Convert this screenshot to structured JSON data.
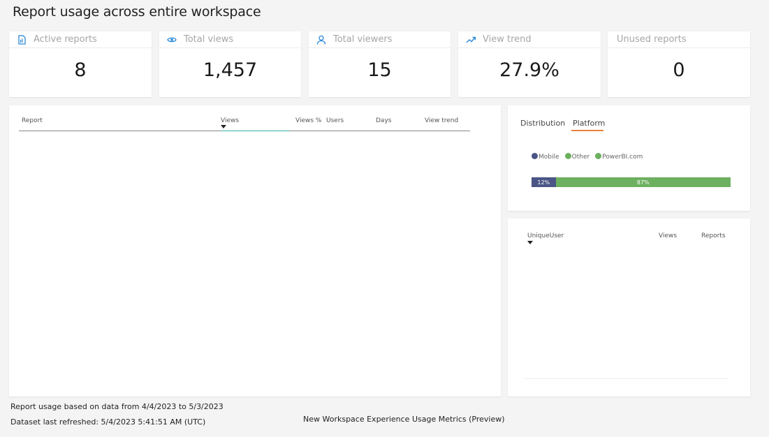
{
  "page": {
    "title": "Report usage across entire workspace"
  },
  "kpis": [
    {
      "label": "Active reports",
      "value": "8",
      "icon": "report-icon"
    },
    {
      "label": "Total views",
      "value": "1,457",
      "icon": "eye-icon"
    },
    {
      "label": "Total viewers",
      "value": "15",
      "icon": "person-icon"
    },
    {
      "label": "View trend",
      "value": "27.9%",
      "icon": "trend-up-icon"
    },
    {
      "label": "Unused reports",
      "value": "0",
      "icon": ""
    }
  ],
  "report_table": {
    "columns": [
      "Report",
      "Views",
      "Views %",
      "Users",
      "Days",
      "View trend"
    ],
    "sorted_column": "Views",
    "rows": []
  },
  "distribution": {
    "tabs": [
      "Distribution",
      "Platform"
    ],
    "active_tab": "Platform",
    "legend": [
      {
        "name": "Mobile",
        "color": "#4a5585"
      },
      {
        "name": "Other",
        "color": "#6db05f"
      },
      {
        "name": "PowerBI.com",
        "color": "#6db05f"
      }
    ],
    "bar": [
      {
        "label": "12%",
        "value": 12,
        "color": "#4a5585"
      },
      {
        "label": "87%",
        "value": 87,
        "color": "#6db05f"
      }
    ]
  },
  "user_table": {
    "columns": [
      "UniqueUser",
      "Views",
      "Reports"
    ],
    "sorted_column": "UniqueUser",
    "rows": []
  },
  "footer": {
    "date_range": "Report usage based on data from 4/4/2023 to 5/3/2023",
    "refreshed": "Dataset last refreshed: 5/4/2023 5:41:51 AM (UTC)",
    "product": "New Workspace Experience Usage Metrics (Preview)"
  },
  "colors": {
    "accent_icon": "#2b88d8",
    "tab_underline": "#e8823d",
    "sort_underline": "#3cb3a3"
  }
}
